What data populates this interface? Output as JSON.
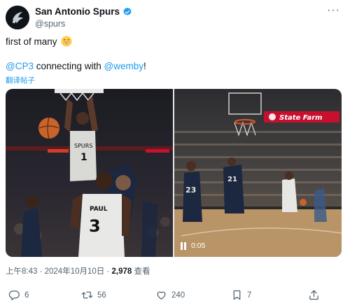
{
  "tweet": {
    "author": {
      "display_name": "San Antonio Spurs",
      "handle": "@spurs",
      "avatar_icon": "spurs-logo-icon",
      "verified_icon": "verified-badge-icon"
    },
    "more_icon": "more-options-icon",
    "text_line1": "first of many",
    "emoji_icon": "grinning-emoji-icon",
    "mention1": "@CP3",
    "text_mid": " connecting with ",
    "mention2": "@wemby",
    "text_end": "!",
    "translate": "翻译帖子",
    "media": {
      "photo_jersey_top": "SPURS",
      "photo_jersey_number": "1",
      "photo_jersey_bottom_name": "PAUL",
      "photo_jersey_bottom_number": "3",
      "video_sponsor": "State Farm",
      "video_time": "0:05",
      "pause_icon": "pause-icon"
    },
    "meta": {
      "time": "上午8:43",
      "sep1": " · ",
      "date": "2024年10月10日",
      "sep2": " · ",
      "views": "2,978",
      "views_label": " 查看"
    },
    "actions": {
      "reply": {
        "icon": "reply-icon",
        "count": "6"
      },
      "repost": {
        "icon": "repost-icon",
        "count": "56"
      },
      "like": {
        "icon": "like-icon",
        "count": "240"
      },
      "bookmark": {
        "icon": "bookmark-icon",
        "count": "7"
      },
      "share": {
        "icon": "share-icon"
      }
    },
    "colors": {
      "link": "#1d9bf0",
      "secondary_text": "#536471",
      "primary_text": "#0f1419",
      "verified": "#1d9bf0"
    }
  }
}
